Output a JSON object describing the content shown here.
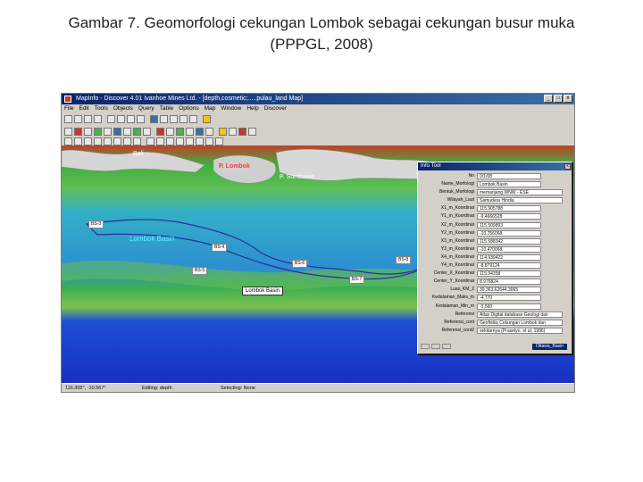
{
  "caption": {
    "line1": "Gambar 7. Geomorfologi cekungan Lombok sebagai cekungan busur muka",
    "line2": "(PPPGL, 2008)"
  },
  "window": {
    "title": "MapInfo - Discover 4.01    Ivanhoe Mines Ltd. - [depth,cosmetic;.....pulau_land Map]",
    "buttons": [
      "_",
      "□",
      "x"
    ]
  },
  "menu": [
    "File",
    "Edit",
    "Tools",
    "Objects",
    "Query",
    "Table",
    "Options",
    "Map",
    "Window",
    "Help",
    "Discover"
  ],
  "map": {
    "regions": [
      "Bali",
      "P. Lombok",
      "P. Sumbawa",
      "Lombok Basin"
    ],
    "places": [
      "BS-3",
      "BS-4",
      "BS-5",
      "BS-6",
      "BS-7",
      "BS-8"
    ],
    "callout": "Lombok Basin",
    "colors": {
      "deep": "#1838c8",
      "basin": "#2aa6c8",
      "shelf": "#4fb04a",
      "land": "#d8d8d8"
    }
  },
  "info_tool": {
    "title": "Info Tool",
    "close": "x",
    "layer": "Ottawa_Basin",
    "rows": [
      {
        "label": "No",
        "value": "0/1/08"
      },
      {
        "label": "Name_Morfologi",
        "value": "Lombok Basin"
      },
      {
        "label": "Bentuk_Morfologi",
        "value": "memanjang WNW - ESE"
      },
      {
        "label": "Wilayah_Laut",
        "value": "Samudera Hindia"
      },
      {
        "label": "X1_m_Koordinat",
        "value": "115.905788"
      },
      {
        "label": "Y1_m_Koordinat",
        "value": "-9.4666528"
      },
      {
        "label": "X2_m_Koordinat",
        "value": "115.509893"
      },
      {
        "label": "Y2_m_Koordinat",
        "value": "-10.756068"
      },
      {
        "label": "X3_m_Koordinat",
        "value": "115.588342"
      },
      {
        "label": "Y3_m_Koordinat",
        "value": "-10.470068"
      },
      {
        "label": "X4_m_Koordinat",
        "value": "114.939422"
      },
      {
        "label": "Y4_m_Koordinat",
        "value": "-8.879124"
      },
      {
        "label": "Center_X_Koordinat",
        "value": "115.94358"
      },
      {
        "label": "Center_Y_Koordinat",
        "value": "8.976824"
      },
      {
        "label": "Luas_KM_2",
        "value": "39,363.62644.3065"
      },
      {
        "label": "Kedalaman_Maks_m",
        "value": "-4,770"
      },
      {
        "label": "Kedalaman_Min_m",
        "value": "-3,560"
      },
      {
        "label": "Referensi",
        "value": "Atlas Digital database Geologi dan"
      },
      {
        "label": "Referensi_cont",
        "value": "Geofisika Cekungan Lombok dan"
      },
      {
        "label": "Referensi_cont2",
        "value": "sekitarnya (Prasetyo, et al, 1996)"
      }
    ]
  },
  "statusbar": {
    "coords": "116.305°, -10.567°",
    "editing": "Editing: depth",
    "selecting": "Selecting: None"
  }
}
